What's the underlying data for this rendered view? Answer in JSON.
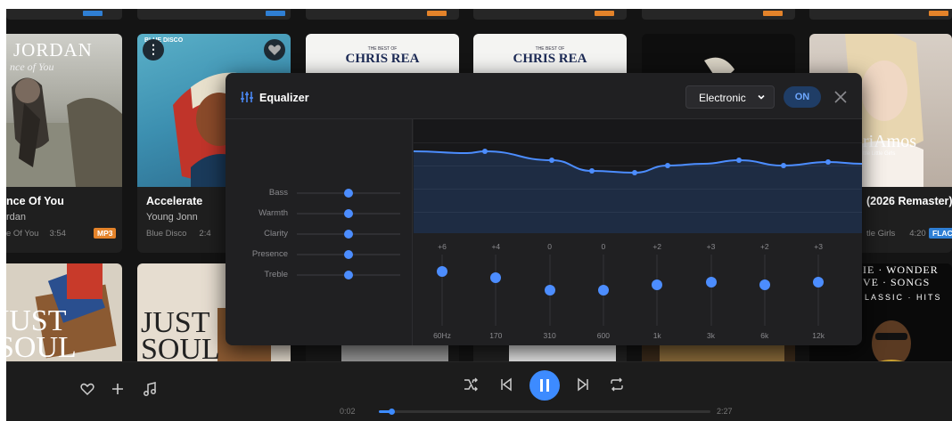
{
  "cards": [
    {
      "title": "nce Of You",
      "artist": "rdan",
      "album": "e Of You",
      "duration": "3:54",
      "badge": "MP3",
      "art_text_big": "JORDAN",
      "art_text_small": "nce of You"
    },
    {
      "title": "Accelerate",
      "artist": "Young Jonn",
      "album": "Blue Disco",
      "duration": "2:4",
      "art_label": "BLUE DISCO"
    },
    {
      "art_title": "CHRIS REA",
      "art_sub": "THE BEST OF"
    },
    {
      "art_title": "CHRIS REA",
      "art_sub": "THE BEST OF"
    },
    {},
    {
      "title": "(2026 Remaster)",
      "album": "tle Girls",
      "duration": "4:20",
      "badge": "FLAC",
      "art_text": "riAmos",
      "art_sub": "ttle Little Girls"
    }
  ],
  "row2": {
    "just_soul_1": [
      "JUST",
      "SOUL"
    ],
    "just_soul_2": [
      "JUST",
      "SOUL"
    ],
    "stevie": [
      "IE · WONDER",
      "VE · SONGS",
      "LASSIC · HITS"
    ]
  },
  "equalizer": {
    "title": "Equalizer",
    "preset": "Electronic",
    "toggle": "ON",
    "knobs": [
      {
        "label": "Bass",
        "value": 0.5
      },
      {
        "label": "Warmth",
        "value": 0.5
      },
      {
        "label": "Clarity",
        "value": 0.5
      },
      {
        "label": "Presence",
        "value": 0.5
      },
      {
        "label": "Treble",
        "value": 0.5
      }
    ],
    "bands": [
      {
        "freq": "60Hz",
        "gain": "+6",
        "level": 0.76
      },
      {
        "freq": "170",
        "gain": "+4",
        "level": 0.68
      },
      {
        "freq": "310",
        "gain": "0",
        "level": 0.5
      },
      {
        "freq": "600",
        "gain": "0",
        "level": 0.5
      },
      {
        "freq": "1k",
        "gain": "+2",
        "level": 0.57
      },
      {
        "freq": "3k",
        "gain": "+3",
        "level": 0.61
      },
      {
        "freq": "6k",
        "gain": "+2",
        "level": 0.57
      },
      {
        "freq": "12k",
        "gain": "+3",
        "level": 0.61
      }
    ]
  },
  "player": {
    "elapsed": "0:02",
    "total": "2:27",
    "progress": 0.02
  },
  "colors": {
    "accent": "#3d8bff",
    "mp3": "#e4832a",
    "flac": "#2f7fd4"
  }
}
